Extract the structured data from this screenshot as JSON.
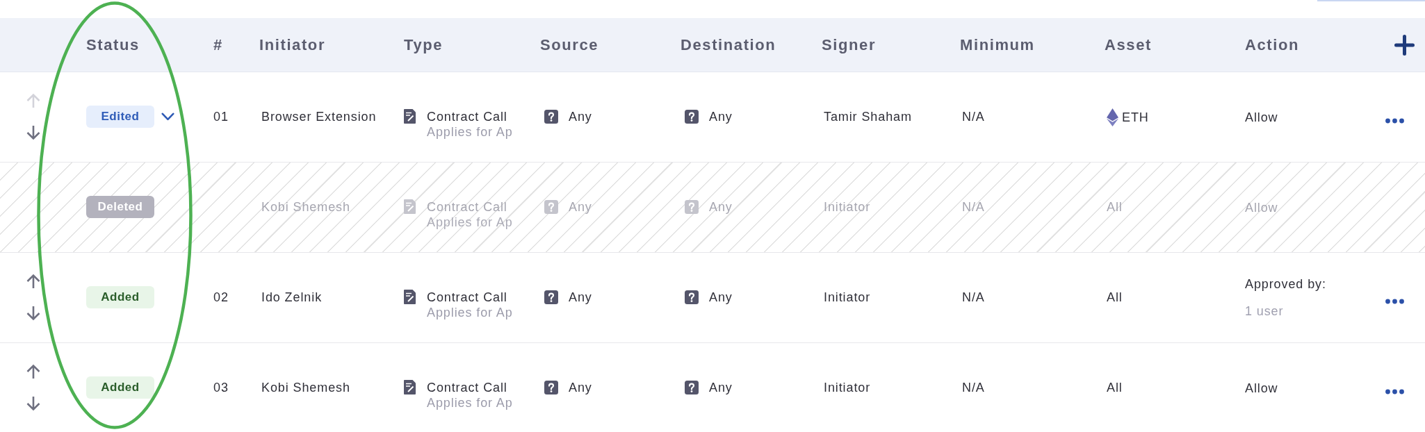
{
  "table": {
    "columns": [
      "Status",
      "#",
      "Initiator",
      "Type",
      "Source",
      "Destination",
      "Signer",
      "Minimum",
      "Asset",
      "Action"
    ],
    "rows": [
      {
        "kind": "edited",
        "reorder": {
          "up_disabled": true,
          "down_disabled": false
        },
        "status": "Edited",
        "expandable": true,
        "number": "01",
        "initiator": "Browser Extension",
        "type": {
          "label": "Contract Call",
          "detail": "Applies for Ap"
        },
        "source": "Any",
        "destination": "Any",
        "signer": "Tamir Shaham",
        "minimum": "N/A",
        "asset": {
          "kind": "coin",
          "label": "ETH"
        },
        "action": {
          "label": "Allow"
        },
        "menu": true
      },
      {
        "kind": "deleted",
        "status": "Deleted",
        "expandable": false,
        "initiator": "Kobi Shemesh",
        "type": {
          "label": "Contract Call",
          "detail": "Applies for Ap"
        },
        "source": "Any",
        "destination": "Any",
        "signer": "Initiator",
        "minimum": "N/A",
        "asset": {
          "kind": "plain",
          "label": "All"
        },
        "action": {
          "label": "Allow"
        },
        "menu": false
      },
      {
        "kind": "added",
        "reorder": {
          "up_disabled": false,
          "down_disabled": false
        },
        "status": "Added",
        "expandable": false,
        "number": "02",
        "initiator": "Ido Zelnik",
        "type": {
          "label": "Contract Call",
          "detail": "Applies for Ap"
        },
        "source": "Any",
        "destination": "Any",
        "signer": "Initiator",
        "minimum": "N/A",
        "asset": {
          "kind": "plain",
          "label": "All"
        },
        "action": {
          "label": "Approved by:",
          "detail": "1 user"
        },
        "menu": true
      },
      {
        "kind": "added",
        "reorder": {
          "up_disabled": false,
          "down_disabled": false
        },
        "status": "Added",
        "expandable": false,
        "number": "03",
        "initiator": "Kobi Shemesh",
        "type": {
          "label": "Contract Call",
          "detail": "Applies for Ap"
        },
        "source": "Any",
        "destination": "Any",
        "signer": "Initiator",
        "minimum": "N/A",
        "asset": {
          "kind": "plain",
          "label": "All"
        },
        "action": {
          "label": "Allow"
        },
        "menu": true
      }
    ]
  }
}
